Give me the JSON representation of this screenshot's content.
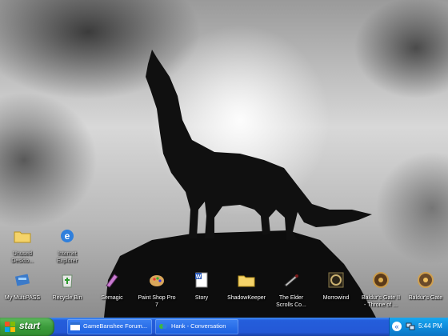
{
  "desktop": {
    "icons": [
      {
        "name": "unused-desktop-shortcuts-icon",
        "label": "Unused\nDeskto...",
        "dim": true
      },
      {
        "name": "internet-explorer-icon",
        "label": "Internet\nExplorer",
        "dim": true
      },
      {
        "name": "my-multipass-icon",
        "label": "My MultiPASS"
      },
      {
        "name": "recycle-bin-icon",
        "label": "Recycle Bin"
      },
      {
        "name": "semagic-icon",
        "label": "Semagic"
      },
      {
        "name": "paint-shop-pro-icon",
        "label": "Paint Shop Pro\n7"
      },
      {
        "name": "story-icon",
        "label": "Story"
      },
      {
        "name": "shadowkeeper-icon",
        "label": "ShadowKeeper"
      },
      {
        "name": "elder-scrolls-icon",
        "label": "The Elder\nScrolls Co..."
      },
      {
        "name": "morrowind-icon",
        "label": "Morrowind"
      },
      {
        "name": "baldurs-gate-ii-icon",
        "label": "Baldur's Gate II\n- Throne of ..."
      },
      {
        "name": "baldurs-gate-icon",
        "label": "Baldur's Gate"
      }
    ]
  },
  "taskbar": {
    "start_label": "start",
    "tasks": [
      {
        "label": "GameBanshee Forum..."
      },
      {
        "label": "Hank - Conversation"
      }
    ],
    "clock": "5:44 PM"
  },
  "colors": {
    "taskbar_blue": "#245edb",
    "start_green": "#3c9c3c",
    "tray_blue": "#0f8ddd"
  }
}
